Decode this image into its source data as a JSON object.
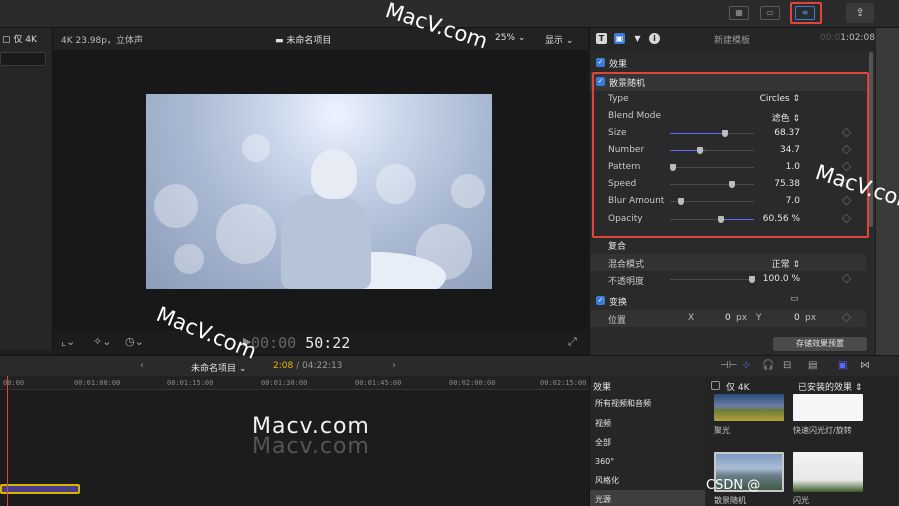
{
  "top_toolbar": {
    "view_buttons": [
      "grid-icon",
      "filmstrip-icon",
      "inspector-sliders-icon"
    ],
    "share_icon": "share-icon"
  },
  "browser": {
    "only_4k_label": "仅 4K"
  },
  "viewer": {
    "format": "4K 23.98p，立体声",
    "project_name": "未命名项目",
    "zoom": "25%",
    "display_menu": "显示",
    "timecode_dim": "00:00",
    "timecode": "50:22"
  },
  "inspector": {
    "template_name": "新建模板",
    "timecode_dim": "00:0",
    "timecode": "1:02:08",
    "effects_section": "效果",
    "effect_name": "散景随机",
    "params": {
      "type": {
        "label": "Type",
        "value": "Circles"
      },
      "blend_mode": {
        "label": "Blend Mode",
        "value": "滤色"
      },
      "size": {
        "label": "Size",
        "value": "68.37"
      },
      "number": {
        "label": "Number",
        "value": "34.7"
      },
      "pattern": {
        "label": "Pattern",
        "value": "1.0"
      },
      "speed": {
        "label": "Speed",
        "value": "75.38"
      },
      "blur_amount": {
        "label": "Blur Amount",
        "value": "7.0"
      },
      "opacity": {
        "label": "Opacity",
        "value": "60.56",
        "unit": "%"
      }
    },
    "composite_section": "复合",
    "composite_params": {
      "blend_mode": {
        "label": "混合模式",
        "value": "正常"
      },
      "opacity": {
        "label": "不透明度",
        "value": "100.0",
        "unit": "%"
      }
    },
    "transform_section": "变换",
    "position": {
      "label": "位置",
      "x_label": "X",
      "x_value": "0",
      "y_label": "Y",
      "y_value": "0",
      "unit": "px"
    },
    "save_preset": "存储效果预置"
  },
  "timeline_bar": {
    "project_name": "未命名项目",
    "current_time": "2:08",
    "total_time": "/ 04:22:13"
  },
  "timeline": {
    "ruler_ticks": [
      "00:00",
      "00:01:00:00",
      "00:01:15:00",
      "00:01:30:00",
      "00:01:45:00",
      "00:02:00:00",
      "00:02:15:00"
    ],
    "watermark_main": "Macv.com",
    "watermark_shadow": "Macv.com"
  },
  "effects_browser": {
    "header": "效果",
    "categories": [
      "所有视频和音频",
      "视频",
      "全部",
      "360°",
      "风格化",
      "光源"
    ],
    "only_4k": "仅 4K",
    "installed": "已安装的效果",
    "thumbs": [
      "聚光",
      "快速闪光灯/旋转",
      "散景随机",
      "闪光"
    ]
  },
  "overlays": {
    "watermark": "MacV.com",
    "csdn_credit": "CSDN @"
  },
  "colors": {
    "accent_blue": "#3d7bd9",
    "highlight_red": "#e0443a",
    "playhead": "#e0443a",
    "clip_border": "#d8b400"
  }
}
